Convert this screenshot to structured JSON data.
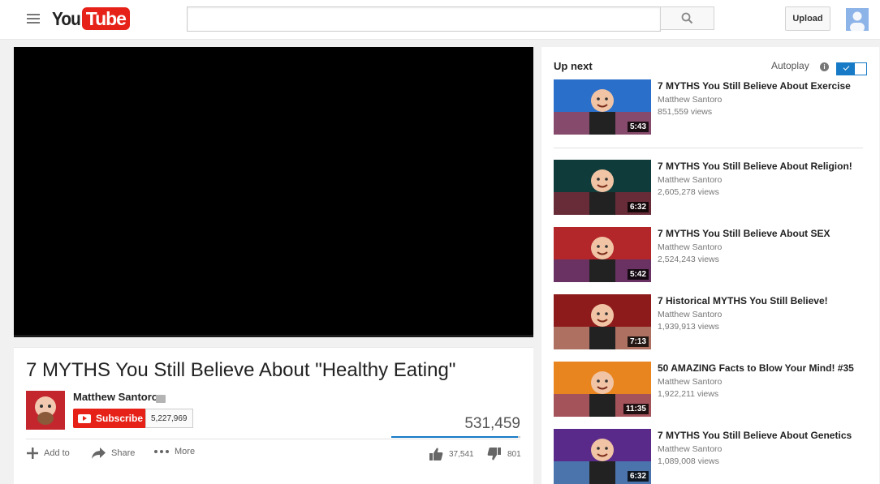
{
  "header": {
    "logo_you": "You",
    "logo_tube": "Tube",
    "search_value": "",
    "upload_label": "Upload",
    "brand_color": "#e62117"
  },
  "video": {
    "title": "7 MYTHS You Still Believe About \"Healthy Eating\"",
    "channel": "Matthew Santoro",
    "subscribe_label": "Subscribe",
    "subscriber_count": "5,227,969",
    "view_count": "531,459",
    "like_ratio": 0.979,
    "actions": {
      "add_to": "Add to",
      "share": "Share",
      "more": "More"
    },
    "likes": "37,541",
    "dislikes": "801"
  },
  "sidebar": {
    "up_next": "Up next",
    "autoplay_label": "Autoplay",
    "autoplay_on": true,
    "accent_color": "#167ac6",
    "items": [
      {
        "title": "7 MYTHS You Still Believe About Exercise",
        "channel": "Matthew Santoro",
        "views": "851,559 views",
        "duration": "5:43",
        "thumb_bg": "#2a6fc9",
        "thumb_accent": "#d22b1f"
      },
      {
        "title": "7 MYTHS You Still Believe About Religion!",
        "channel": "Matthew Santoro",
        "views": "2,605,278 views",
        "duration": "6:32",
        "thumb_bg": "#0f3b3a",
        "thumb_accent": "#b22038"
      },
      {
        "title": "7 MYTHS You Still Believe About SEX",
        "channel": "Matthew Santoro",
        "views": "2,524,243 views",
        "duration": "5:42",
        "thumb_bg": "#b3262a",
        "thumb_accent": "#2b3c8f"
      },
      {
        "title": "7 Historical MYTHS You Still Believe!",
        "channel": "Matthew Santoro",
        "views": "1,939,913 views",
        "duration": "7:13",
        "thumb_bg": "#8e1b1b",
        "thumb_accent": "#c8b79a"
      },
      {
        "title": "50 AMAZING Facts to Blow Your Mind! #35",
        "channel": "Matthew Santoro",
        "views": "1,922,211 views",
        "duration": "11:35",
        "thumb_bg": "#e8851e",
        "thumb_accent": "#6b2a8e"
      },
      {
        "title": "7 MYTHS You Still Believe About Genetics",
        "channel": "Matthew Santoro",
        "views": "1,089,008 views",
        "duration": "6:32",
        "thumb_bg": "#5a2a8a",
        "thumb_accent": "#3fb0c8"
      }
    ]
  }
}
